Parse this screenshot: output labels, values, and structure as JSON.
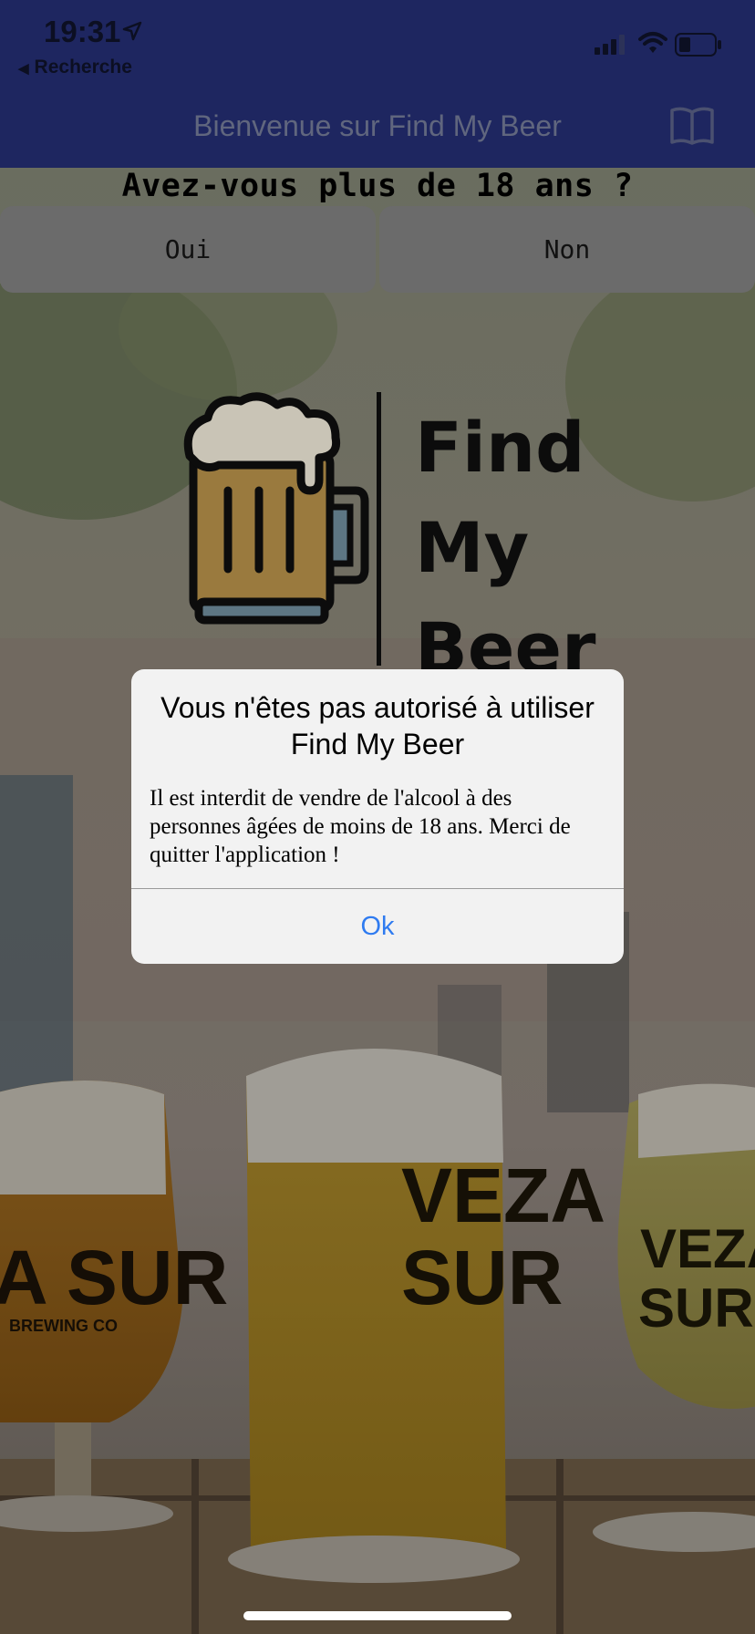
{
  "status_bar": {
    "time": "19:31",
    "back_label": "Recherche",
    "icons": [
      "location-arrow-icon",
      "signal-icon",
      "wifi-icon",
      "battery-icon"
    ]
  },
  "nav": {
    "title": "Bienvenue sur Find My Beer",
    "book_icon": "book-icon"
  },
  "age_check": {
    "question": "Avez-vous plus de 18 ans ?",
    "yes_label": "Oui",
    "no_label": "Non"
  },
  "logo": {
    "lines": [
      "Find",
      "My",
      "Beer"
    ],
    "icon": "beer-mug-icon"
  },
  "background": {
    "glass_texts": [
      "A SUR",
      "BREWING CO",
      "VEZA",
      "SUR",
      "VEZA",
      "SUR",
      "BREWING CO"
    ]
  },
  "dialog": {
    "title": "Vous n'êtes pas autorisé à utiliser Find My Beer",
    "message": "Il est interdit de vendre de l'alcool à des personnes âgées de moins de 18 ans. Merci de quitter l'application !",
    "ok_label": "Ok"
  },
  "colors": {
    "navbar": "#1e2660",
    "dialog_bg": "#f2f2f2",
    "ok_blue": "#2f7bf0",
    "button_gray": "#6b6b6b"
  }
}
